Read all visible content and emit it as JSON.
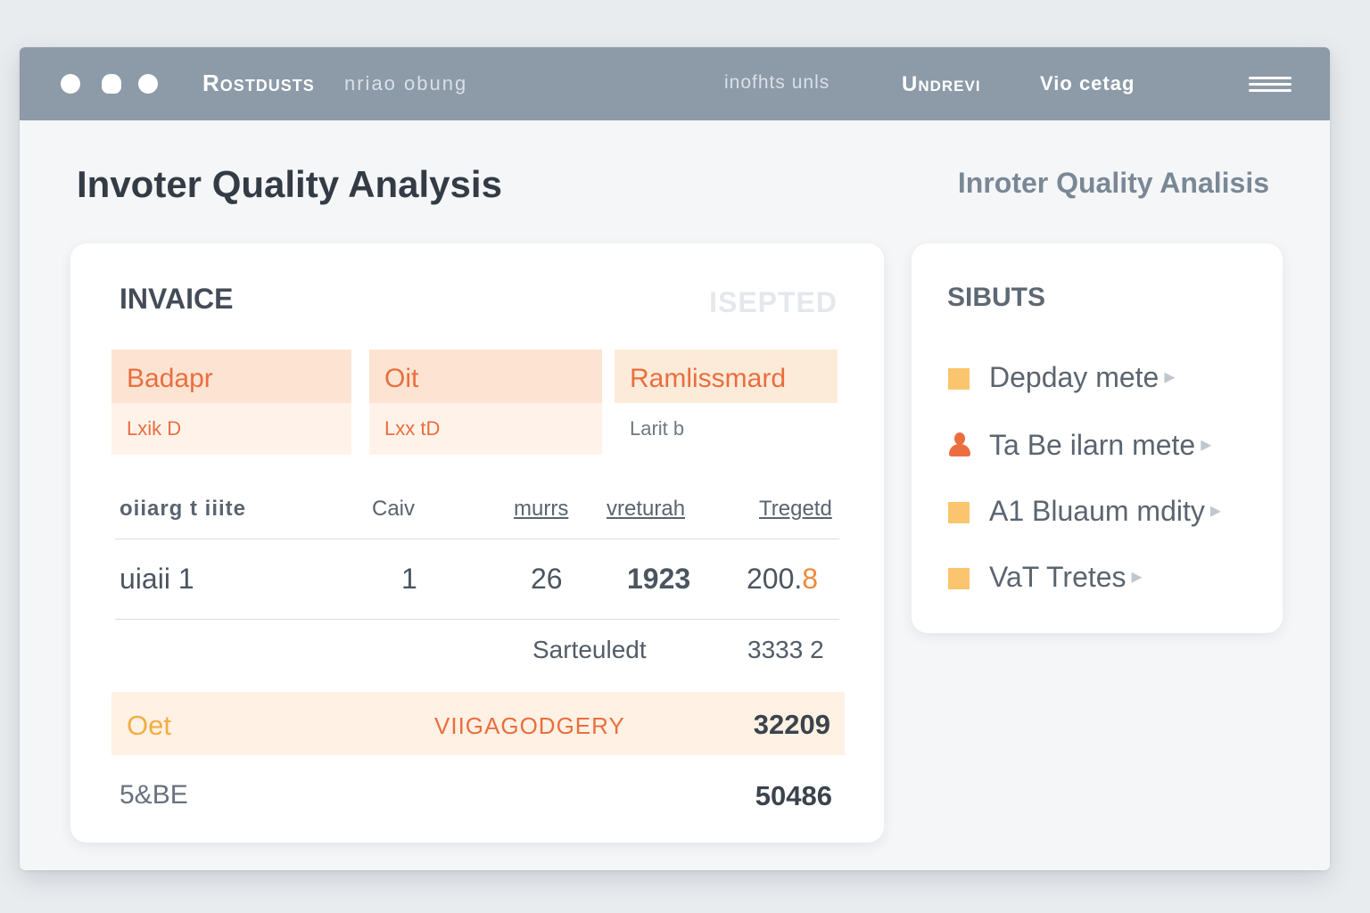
{
  "header": {
    "brand": "Rostdusts",
    "brand_sub": "nriao obung",
    "nav": [
      {
        "label": "inofhts unls"
      },
      {
        "label": "Undrevi"
      },
      {
        "label": "Vio cetag"
      }
    ]
  },
  "page": {
    "title": "Invoter Quality Analysis",
    "subtitle": "Inroter Quality Analisis"
  },
  "invoice": {
    "title": "INVAICE",
    "status": "ISEPTED",
    "tiles": [
      {
        "head": "Badapr",
        "sub": "Lxik D"
      },
      {
        "head": "Oit",
        "sub": "Lxx tD"
      },
      {
        "head": "Ramlissmard",
        "sub": "Larit b"
      }
    ],
    "columns": [
      "oiiarg t iiite",
      "Caiv",
      "murrs",
      "vreturah",
      "Tregetd"
    ],
    "rows": [
      {
        "c0": "uiaii 1",
        "c1": "1",
        "c2": "26",
        "c3": "1923",
        "c4_main": "200.",
        "c4_accent": "8"
      }
    ],
    "subtotal": {
      "label": "Sarteuledt",
      "value": "3333 2"
    },
    "highlight": {
      "label": "Oet",
      "mid": "VIIGAGODGERY",
      "value": "32209"
    },
    "footer": {
      "label": "5&BE",
      "value": "50486"
    }
  },
  "side": {
    "title": "SIBUTS",
    "items": [
      {
        "label": "Depday mete",
        "icon": "square-icon"
      },
      {
        "label": "Ta Be ilarn mete",
        "icon": "person-icon"
      },
      {
        "label": "A1 Bluaum mdity",
        "icon": "square-icon"
      },
      {
        "label": "VaT Tretes",
        "icon": "square-icon"
      }
    ]
  },
  "colors": {
    "topbar": "#8d9aa8",
    "accent_orange": "#ea6e3f",
    "accent_yellow": "#fac56e",
    "tile_bg": "#fde4d2"
  }
}
